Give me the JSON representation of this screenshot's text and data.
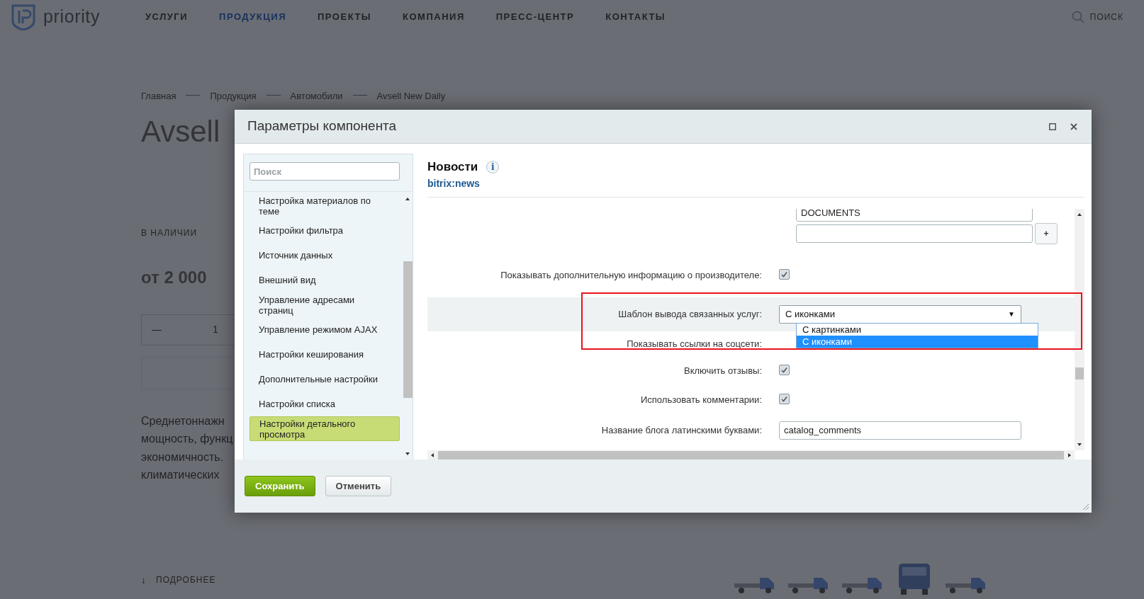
{
  "site": {
    "logo": "priority",
    "nav": [
      {
        "label": "УСЛУГИ",
        "selected": false
      },
      {
        "label": "ПРОДУКЦИЯ",
        "selected": true
      },
      {
        "label": "ПРОЕКТЫ",
        "selected": false
      },
      {
        "label": "КОМПАНИЯ",
        "selected": false
      },
      {
        "label": "ПРЕСС-ЦЕНТР",
        "selected": false
      },
      {
        "label": "КОНТАКТЫ",
        "selected": false
      }
    ],
    "search": "ПОИСК",
    "breadcrumbs": [
      "Главная",
      "Продукция",
      "Автомобили",
      "Avsell New Daily"
    ],
    "title": "Avsell",
    "availability": "В НАЛИЧИИ",
    "price": "от 2 000",
    "quantity": {
      "minus": "—",
      "value": "1"
    },
    "description": [
      "Среднетоннажн",
      "мощность, функц",
      "экономичность.",
      "климатических"
    ],
    "more": "ПОДРОБНЕЕ",
    "more_arrow": "↓"
  },
  "dialog": {
    "title": "Параметры компонента",
    "sidebar": {
      "search_placeholder": "Поиск",
      "items": [
        {
          "label": "Настройка материалов по теме",
          "selected": false
        },
        {
          "label": "Настройки фильтра",
          "selected": false
        },
        {
          "label": "Источник данных",
          "selected": false
        },
        {
          "label": "Внешний вид",
          "selected": false
        },
        {
          "label": "Управление адресами страниц",
          "selected": false
        },
        {
          "label": "Управление режимом AJAX",
          "selected": false
        },
        {
          "label": "Настройки кеширования",
          "selected": false
        },
        {
          "label": "Дополнительные настройки",
          "selected": false
        },
        {
          "label": "Настройки списка",
          "selected": false
        },
        {
          "label": "Настройки детального просмотра",
          "selected": true
        }
      ]
    },
    "component": {
      "name": "Новости",
      "code": "bitrix:news",
      "info": "i"
    },
    "fields": [
      {
        "kind": "inputs",
        "values": [
          "DOCUMENTS"
        ],
        "add_button": "+"
      },
      {
        "kind": "checkbox",
        "label": "Показывать дополнительную информацию о производителе:",
        "checked": true
      },
      {
        "kind": "select",
        "label": "Шаблон вывода связанных услуг:",
        "value": "С иконками",
        "arrow": "▼",
        "options": [
          {
            "label": "С картинками",
            "selected": false
          },
          {
            "label": "С иконками",
            "selected": true
          }
        ]
      },
      {
        "kind": "label",
        "label": "Показывать ссылки на соцсети:"
      },
      {
        "kind": "checkbox",
        "label": "Включить отзывы:",
        "checked": true
      },
      {
        "kind": "checkbox",
        "label": "Использовать комментарии:",
        "checked": true
      },
      {
        "kind": "text",
        "label": "Название блога латинскими буквами:",
        "value": "catalog_comments"
      }
    ],
    "buttons": [
      {
        "label": "Сохранить",
        "kind": "primary"
      },
      {
        "label": "Отменить",
        "kind": "secondary"
      }
    ]
  }
}
